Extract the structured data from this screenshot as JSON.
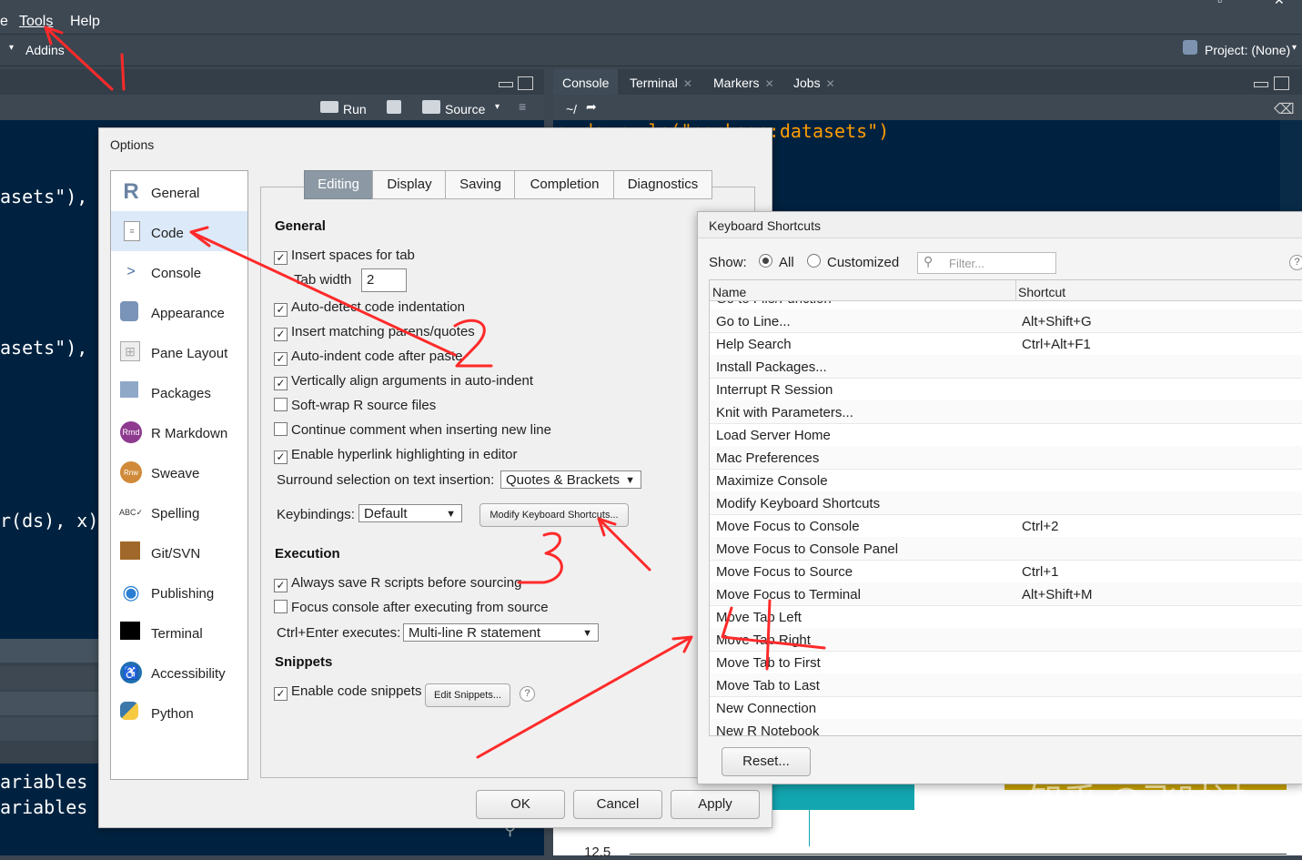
{
  "menubar": {
    "items": [
      "e",
      "Tools",
      "Help"
    ]
  },
  "toolbar": {
    "addins": "Addins",
    "project": "Project: (None)"
  },
  "editor": {
    "run": "Run",
    "source": "Source",
    "code_lines": [
      "asets\"), ",
      "asets\"), ",
      "r(ds), x)"
    ],
    "env_lines": [
      "ariables",
      "ariables"
    ]
  },
  "console": {
    "tabs": [
      {
        "label": "Console",
        "closable": false
      },
      {
        "label": "Terminal",
        "closable": true
      },
      {
        "label": "Markers",
        "closable": true
      },
      {
        "label": "Jobs",
        "closable": true
      }
    ],
    "path": "~/",
    "line": "> ds <- ls(\"package:datasets\")",
    "plot_tick": "12.5"
  },
  "options": {
    "title": "Options",
    "categories": [
      {
        "label": "General",
        "icon": "r-logo-icon"
      },
      {
        "label": "Code",
        "icon": "code-file-icon",
        "selected": true
      },
      {
        "label": "Console",
        "icon": "console-prompt-icon"
      },
      {
        "label": "Appearance",
        "icon": "paint-bucket-icon"
      },
      {
        "label": "Pane Layout",
        "icon": "pane-grid-icon"
      },
      {
        "label": "Packages",
        "icon": "package-box-icon"
      },
      {
        "label": "R Markdown",
        "icon": "rmd-icon"
      },
      {
        "label": "Sweave",
        "icon": "sweave-icon"
      },
      {
        "label": "Spelling",
        "icon": "spelling-abc-icon"
      },
      {
        "label": "Git/SVN",
        "icon": "git-box-icon"
      },
      {
        "label": "Publishing",
        "icon": "publish-icon"
      },
      {
        "label": "Terminal",
        "icon": "terminal-icon"
      },
      {
        "label": "Accessibility",
        "icon": "accessibility-icon"
      },
      {
        "label": "Python",
        "icon": "python-icon"
      }
    ],
    "tabs": [
      "Editing",
      "Display",
      "Saving",
      "Completion",
      "Diagnostics"
    ],
    "general": {
      "heading": "General",
      "insert_spaces": "Insert spaces for tab",
      "tab_width_label": "Tab width",
      "tab_width_value": "2",
      "items": [
        {
          "label": "Auto-detect code indentation",
          "checked": true
        },
        {
          "label": "Insert matching parens/quotes",
          "checked": true
        },
        {
          "label": "Auto-indent code after paste",
          "checked": true
        },
        {
          "label": "Vertically align arguments in auto-indent",
          "checked": true
        },
        {
          "label": "Soft-wrap R source files",
          "checked": false
        },
        {
          "label": "Continue comment when inserting new line",
          "checked": false
        },
        {
          "label": "Enable hyperlink highlighting in editor",
          "checked": true
        }
      ],
      "surround_label": "Surround selection on text insertion:",
      "surround_value": "Quotes & Brackets",
      "keybindings_label": "Keybindings:",
      "keybindings_value": "Default",
      "modify_button": "Modify Keyboard Shortcuts..."
    },
    "execution": {
      "heading": "Execution",
      "always_save": "Always save R scripts before sourcing",
      "focus_console": "Focus console after executing from source",
      "ctrl_enter_label": "Ctrl+Enter executes:",
      "ctrl_enter_value": "Multi-line R statement"
    },
    "snippets": {
      "heading": "Snippets",
      "enable": "Enable code snippets",
      "edit_button": "Edit Snippets..."
    },
    "buttons": {
      "ok": "OK",
      "cancel": "Cancel",
      "apply": "Apply"
    }
  },
  "shortcuts": {
    "title": "Keyboard Shortcuts",
    "show_label": "Show:",
    "all": "All",
    "customized": "Customized",
    "filter_placeholder": "Filter...",
    "col_name": "Name",
    "col_shortcut": "Shortcut",
    "rows": [
      {
        "name": "Go to File/Function",
        "shortcut": ""
      },
      {
        "name": "Go to Line...",
        "shortcut": "Alt+Shift+G"
      },
      {
        "name": "Help Search",
        "shortcut": "Ctrl+Alt+F1"
      },
      {
        "name": "Install Packages...",
        "shortcut": ""
      },
      {
        "name": "Interrupt R Session",
        "shortcut": ""
      },
      {
        "name": "Knit with Parameters...",
        "shortcut": ""
      },
      {
        "name": "Load Server Home",
        "shortcut": ""
      },
      {
        "name": "Mac Preferences",
        "shortcut": ""
      },
      {
        "name": "Maximize Console",
        "shortcut": ""
      },
      {
        "name": "Modify Keyboard Shortcuts",
        "shortcut": ""
      },
      {
        "name": "Move Focus to Console",
        "shortcut": "Ctrl+2"
      },
      {
        "name": "Move Focus to Console Panel",
        "shortcut": ""
      },
      {
        "name": "Move Focus to Source",
        "shortcut": "Ctrl+1"
      },
      {
        "name": "Move Focus to Terminal",
        "shortcut": "Alt+Shift+M"
      },
      {
        "name": "Move Tab Left",
        "shortcut": ""
      },
      {
        "name": "Move Tab Right",
        "shortcut": ""
      },
      {
        "name": "Move Tab to First",
        "shortcut": ""
      },
      {
        "name": "Move Tab to Last",
        "shortcut": ""
      },
      {
        "name": "New Connection",
        "shortcut": ""
      },
      {
        "name": "New R Notebook",
        "shortcut": ""
      }
    ],
    "reset_button": "Reset..."
  },
  "watermark": "知乎 @飞时过",
  "colors": {
    "annotation": "#ff2a2a",
    "editor_bg": "#002240",
    "selected_tab": "#8c99a5"
  }
}
